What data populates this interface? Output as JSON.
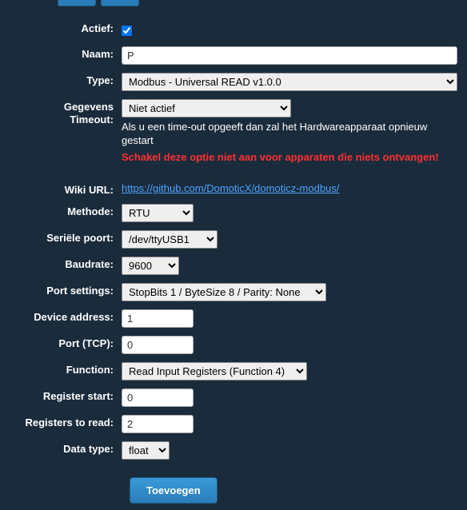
{
  "labels": {
    "actief": "Actief:",
    "naam": "Naam:",
    "type": "Type:",
    "gegevens": "Gegevens",
    "timeout": "Timeout:",
    "wiki": "Wiki URL:",
    "methode": "Methode:",
    "serielepoort": "Seriële poort:",
    "baudrate": "Baudrate:",
    "portsettings": "Port settings:",
    "deviceaddress": "Device address:",
    "porttcp": "Port (TCP):",
    "function": "Function:",
    "registerstart": "Register start:",
    "registerstoread": "Registers to read:",
    "datatype": "Data type:"
  },
  "values": {
    "actief": true,
    "naam": "P",
    "type": "Modbus - Universal READ v1.0.0",
    "gegevens_timeout": "Niet actief",
    "wiki_url": "https://github.com/DomoticX/domoticz-modbus/",
    "methode": "RTU",
    "serielepoort": "/dev/ttyUSB1",
    "baudrate": "9600",
    "portsettings": "StopBits 1 / ByteSize 8 / Parity: None",
    "deviceaddress": "1",
    "porttcp": "0",
    "function": "Read Input Registers (Function 4)",
    "registerstart": "0",
    "registerstoread": "2",
    "datatype": "float"
  },
  "help": {
    "timeout1": "Als u een time-out opgeeft dan zal het Hardwareapparaat opnieuw gestart",
    "timeout2": "Schakel deze optie niet aan voor apparaten die niets ontvangen!"
  },
  "buttons": {
    "toevoegen": "Toevoegen"
  }
}
